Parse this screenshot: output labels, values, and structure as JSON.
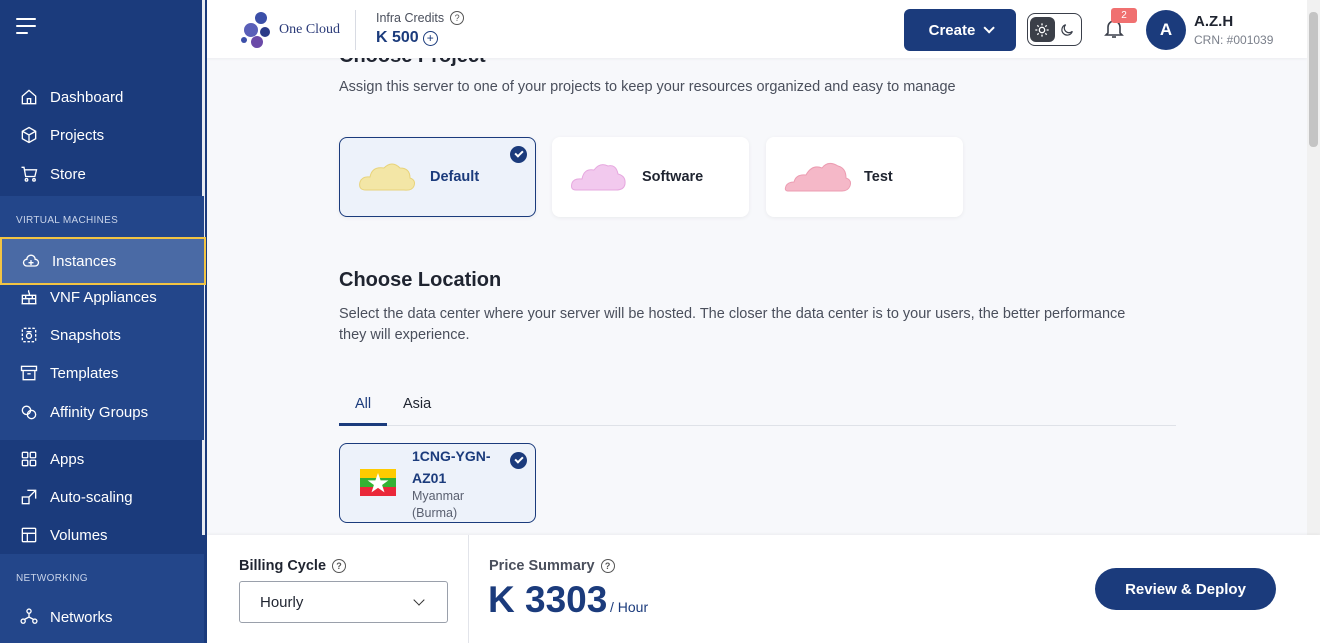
{
  "sidebar": {
    "items_main": [
      {
        "label": "Dashboard",
        "icon": "home-icon"
      },
      {
        "label": "Projects",
        "icon": "cube-icon"
      },
      {
        "label": "Store",
        "icon": "cart-icon"
      }
    ],
    "section_vm": "VIRTUAL MACHINES",
    "items_vm": [
      {
        "label": "Instances",
        "icon": "cloud-plus-icon"
      },
      {
        "label": "VNF Appliances",
        "icon": "firewall-icon"
      },
      {
        "label": "Snapshots",
        "icon": "camera-icon"
      },
      {
        "label": "Templates",
        "icon": "archive-icon"
      },
      {
        "label": "Affinity Groups",
        "icon": "circles-icon"
      }
    ],
    "items_apps": [
      {
        "label": "Apps",
        "icon": "grid-icon"
      },
      {
        "label": "Auto-scaling",
        "icon": "scale-icon"
      },
      {
        "label": "Volumes",
        "icon": "volumes-icon"
      }
    ],
    "section_net": "NETWORKING",
    "items_net": [
      {
        "label": "Networks",
        "icon": "network-icon"
      }
    ]
  },
  "header": {
    "logo_text": "One Cloud",
    "credits_label": "Infra Credits",
    "credits_value": "K 500",
    "create_label": "Create",
    "notification_count": "2",
    "avatar_initial": "A",
    "user_name": "A.Z.H",
    "user_crn": "CRN: #001039"
  },
  "project": {
    "title_partial": "Choose Project",
    "description": "Assign this server to one of your projects to keep your resources organized and easy to manage",
    "cards": [
      {
        "name": "Default",
        "selected": true,
        "cloud_color": "#f3e6a6"
      },
      {
        "name": "Software",
        "selected": false,
        "cloud_color": "#f2c9ee"
      },
      {
        "name": "Test",
        "selected": false,
        "cloud_color": "#f5b8c8"
      }
    ]
  },
  "location": {
    "title": "Choose Location",
    "description_line1": "Select the data center where your server will be hosted. The closer the data center is to your users, the better performance",
    "description_line2": "they will experience.",
    "tabs": [
      "All",
      "Asia"
    ],
    "active_tab": "All",
    "card": {
      "code_line1": "1CNG-YGN-",
      "code_line2": "AZ01",
      "country_line1": "Myanmar",
      "country_line2": "(Burma)"
    }
  },
  "bottom": {
    "billing_label": "Billing Cycle",
    "billing_value": "Hourly",
    "price_label": "Price Summary",
    "price_value": "K 3303",
    "price_unit": "/ Hour",
    "deploy_label": "Review & Deploy"
  },
  "colors": {
    "primary": "#1b3b7c",
    "sidebar_highlight": "#f2c443",
    "badge": "#f07070"
  }
}
